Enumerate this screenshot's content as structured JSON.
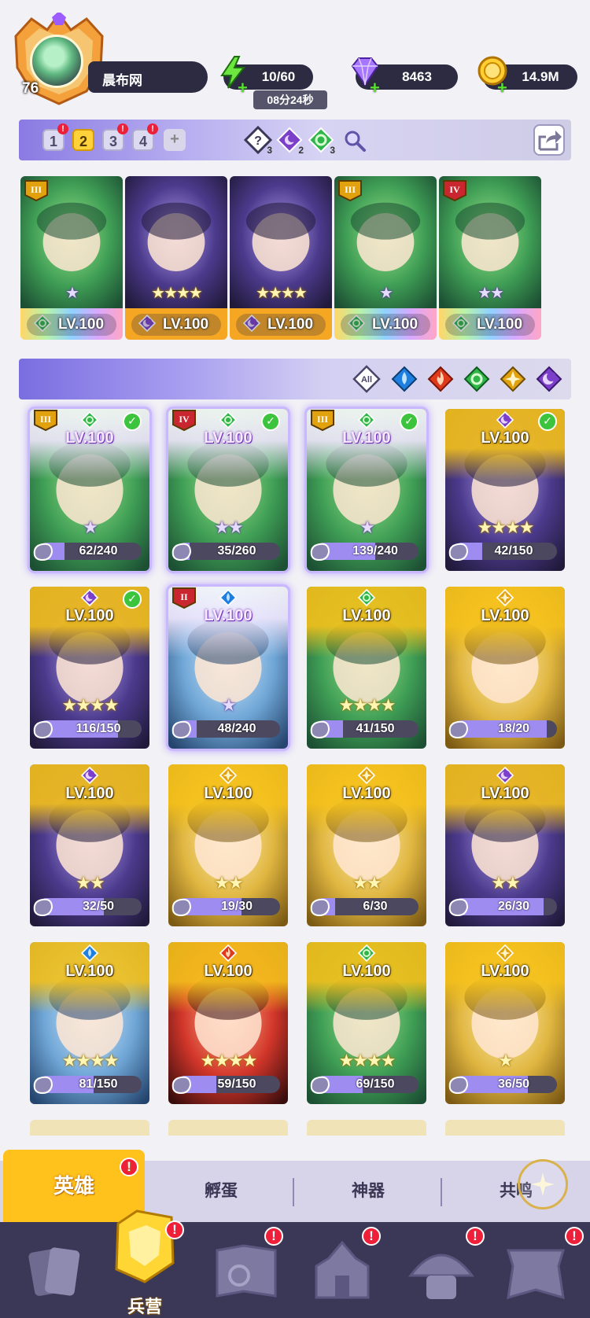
{
  "player": {
    "level": "76",
    "name": "晨布网"
  },
  "resources": {
    "energy": "10/60",
    "energy_timer": "08分24秒",
    "gems": "8463",
    "gold": "14.9M"
  },
  "teams": {
    "tabs": [
      {
        "label": "1",
        "alert": true,
        "active": false
      },
      {
        "label": "2",
        "alert": false,
        "active": true
      },
      {
        "label": "3",
        "alert": true,
        "active": false
      },
      {
        "label": "4",
        "alert": true,
        "active": false
      }
    ],
    "add_label": "+",
    "element_counts": [
      {
        "icon": "unknown-element-icon",
        "count": "3"
      },
      {
        "icon": "moon-element-icon",
        "count": "2"
      },
      {
        "icon": "leaf-element-icon",
        "count": "3"
      }
    ]
  },
  "team_cards": [
    {
      "rank": "III",
      "element": "leaf",
      "stars": 1,
      "star_style": "lavender",
      "level": "LV.100",
      "footer": "rainbow"
    },
    {
      "rank": "",
      "element": "moon",
      "stars": 4,
      "star_style": "gold",
      "level": "LV.100",
      "footer": "gold"
    },
    {
      "rank": "",
      "element": "moon",
      "stars": 4,
      "star_style": "gold",
      "level": "LV.100",
      "footer": "gold"
    },
    {
      "rank": "III",
      "element": "leaf",
      "stars": 1,
      "star_style": "lavender",
      "level": "LV.100",
      "footer": "rainbow"
    },
    {
      "rank": "IV",
      "element": "leaf",
      "stars": 2,
      "star_style": "lavender",
      "level": "LV.100",
      "footer": "rainbow"
    }
  ],
  "filters": [
    "All",
    "water",
    "fire",
    "leaf",
    "light",
    "moon"
  ],
  "heroes": [
    {
      "rank": "III",
      "element": "leaf",
      "checked": true,
      "level": "LV.100",
      "stars": 1,
      "star_style": "lavender",
      "count": "62/240",
      "progress": 0.26,
      "theme": "purple",
      "selected": true
    },
    {
      "rank": "IV",
      "element": "leaf",
      "checked": true,
      "level": "LV.100",
      "stars": 2,
      "star_style": "lavender",
      "count": "35/260",
      "progress": 0.13,
      "theme": "purple",
      "selected": true
    },
    {
      "rank": "III",
      "element": "leaf",
      "checked": true,
      "level": "LV.100",
      "stars": 1,
      "star_style": "lavender",
      "count": "139/240",
      "progress": 0.58,
      "theme": "purple",
      "selected": true
    },
    {
      "rank": "",
      "element": "moon",
      "checked": true,
      "level": "LV.100",
      "stars": 4,
      "star_style": "gold",
      "count": "42/150",
      "progress": 0.28,
      "theme": "gold",
      "selected": false
    },
    {
      "rank": "",
      "element": "moon",
      "checked": true,
      "level": "LV.100",
      "stars": 4,
      "star_style": "gold",
      "count": "116/150",
      "progress": 0.77,
      "theme": "gold",
      "selected": false
    },
    {
      "rank": "II",
      "element": "water",
      "checked": false,
      "level": "LV.100",
      "stars": 1,
      "star_style": "lavender",
      "count": "48/240",
      "progress": 0.2,
      "theme": "purple",
      "selected": true
    },
    {
      "rank": "",
      "element": "leaf",
      "checked": false,
      "level": "LV.100",
      "stars": 4,
      "star_style": "gold",
      "count": "41/150",
      "progress": 0.27,
      "theme": "gold",
      "selected": false
    },
    {
      "rank": "",
      "element": "light",
      "checked": false,
      "level": "LV.100",
      "stars": 0,
      "star_style": "gold",
      "count": "18/20",
      "progress": 0.9,
      "theme": "gold",
      "selected": false
    },
    {
      "rank": "",
      "element": "moon",
      "checked": false,
      "level": "LV.100",
      "stars": 2,
      "star_style": "gold",
      "count": "32/50",
      "progress": 0.64,
      "theme": "gold",
      "selected": false
    },
    {
      "rank": "",
      "element": "light",
      "checked": false,
      "level": "LV.100",
      "stars": 2,
      "star_style": "gold",
      "count": "19/30",
      "progress": 0.63,
      "theme": "gold",
      "selected": false
    },
    {
      "rank": "",
      "element": "light",
      "checked": false,
      "level": "LV.100",
      "stars": 2,
      "star_style": "gold",
      "count": "6/30",
      "progress": 0.2,
      "theme": "gold",
      "selected": false
    },
    {
      "rank": "",
      "element": "moon",
      "checked": false,
      "level": "LV.100",
      "stars": 2,
      "star_style": "gold",
      "count": "26/30",
      "progress": 0.87,
      "theme": "gold",
      "selected": false
    },
    {
      "rank": "",
      "element": "water",
      "checked": false,
      "level": "LV.100",
      "stars": 4,
      "star_style": "gold",
      "count": "81/150",
      "progress": 0.54,
      "theme": "gold",
      "selected": false
    },
    {
      "rank": "",
      "element": "fire",
      "checked": false,
      "level": "LV.100",
      "stars": 4,
      "star_style": "gold",
      "count": "59/150",
      "progress": 0.39,
      "theme": "gold",
      "selected": false
    },
    {
      "rank": "",
      "element": "leaf",
      "checked": false,
      "level": "LV.100",
      "stars": 4,
      "star_style": "gold",
      "count": "69/150",
      "progress": 0.46,
      "theme": "gold",
      "selected": false
    },
    {
      "rank": "",
      "element": "light",
      "checked": false,
      "level": "LV.100",
      "stars": 1,
      "star_style": "gold",
      "count": "36/50",
      "progress": 0.72,
      "theme": "gold",
      "selected": false
    }
  ],
  "subtabs": [
    {
      "label": "英雄",
      "active": true,
      "alert": true
    },
    {
      "label": "孵蛋",
      "active": false,
      "alert": false
    },
    {
      "label": "神器",
      "active": false,
      "alert": false
    },
    {
      "label": "共鸣",
      "active": false,
      "alert": false
    }
  ],
  "nav": [
    {
      "icon": "cards-icon",
      "label": "",
      "alert": false,
      "active": false
    },
    {
      "icon": "barracks-icon",
      "label": "兵营",
      "alert": true,
      "active": true
    },
    {
      "icon": "map-book-icon",
      "label": "",
      "alert": true,
      "active": false
    },
    {
      "icon": "castle-icon",
      "label": "",
      "alert": true,
      "active": false
    },
    {
      "icon": "mushroom-house-icon",
      "label": "",
      "alert": true,
      "active": false
    },
    {
      "icon": "guild-banner-icon",
      "label": "",
      "alert": true,
      "active": false
    }
  ],
  "colors": {
    "leaf": "#2fb54a",
    "moon": "#7b3fc9",
    "water": "#1f7fe0",
    "fire": "#e0391c",
    "light": "#e2a20d",
    "accent_gold": "#ffc21d",
    "nav_bg": "#3b3857"
  }
}
